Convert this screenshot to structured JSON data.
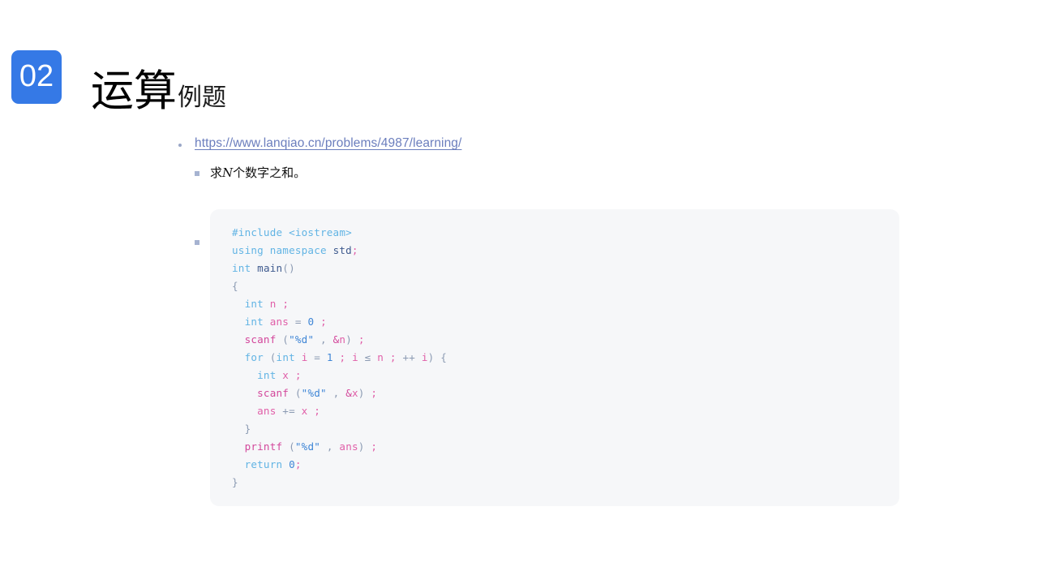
{
  "slide": {
    "section_number": "02",
    "title_main": "运算",
    "title_sub": "例题",
    "badge_color": "#3579e6"
  },
  "bullets": {
    "link": "https://www.lanqiao.cn/problems/4987/learning/",
    "link_color": "#6b7ebd",
    "sub_prefix": "求",
    "sub_italic": "N",
    "sub_suffix": "个数字之和。"
  },
  "code_block": {
    "language": "cpp",
    "background": "#f6f7f9",
    "lines": [
      "#include <iostream>",
      "using namespace std;",
      "int main()",
      "{",
      "  int n ;",
      "  int ans = 0 ;",
      "  scanf (\"%d\" , &n) ;",
      "  for (int i = 1 ; i ≤ n ; ++ i) {",
      "    int x ;",
      "    scanf (\"%d\" , &x) ;",
      "    ans += x ;",
      "  }",
      "  printf (\"%d\" , ans) ;",
      "  return 0;",
      "}"
    ],
    "tokens": {
      "line1": {
        "pre": "#include",
        "header": "<iostream>"
      },
      "line2": {
        "kw1": "using",
        "kw2": "namespace",
        "type": "std",
        "semi": ";"
      },
      "line3": {
        "kw": "int",
        "fn": "main",
        "pun": "()"
      },
      "line4": {
        "pun": "{"
      },
      "line5": {
        "kw": "int",
        "var": "n",
        "semi": ";"
      },
      "line6": {
        "kw": "int",
        "var": "ans",
        "op": "=",
        "num": "0",
        "semi": ";"
      },
      "line7": {
        "fn": "scanf",
        "open": "(",
        "str": "\"%d\"",
        "comma": ",",
        "amp": "&",
        "var": "n",
        "close": ")",
        "semi": ";"
      },
      "line8": {
        "kw1": "for",
        "open": "(",
        "kw2": "int",
        "var1": "i",
        "op1": "=",
        "num": "1",
        "semi1": ";",
        "var2": "i",
        "le": "≤",
        "var3": "n",
        "semi2": ";",
        "inc": "++",
        "var4": "i",
        "close": ")",
        "brace": "{"
      },
      "line9": {
        "kw": "int",
        "var": "x",
        "semi": ";"
      },
      "line10": {
        "fn": "scanf",
        "open": "(",
        "str": "\"%d\"",
        "comma": ",",
        "amp": "&",
        "var": "x",
        "close": ")",
        "semi": ";"
      },
      "line11": {
        "var1": "ans",
        "op": "+=",
        "var2": "x",
        "semi": ";"
      },
      "line12": {
        "pun": "}"
      },
      "line13": {
        "fn": "printf",
        "open": "(",
        "str": "\"%d\"",
        "comma": ",",
        "var": "ans",
        "close": ")",
        "semi": ";"
      },
      "line14": {
        "kw": "return",
        "num": "0",
        "semi": ";"
      },
      "line15": {
        "pun": "}"
      }
    }
  }
}
